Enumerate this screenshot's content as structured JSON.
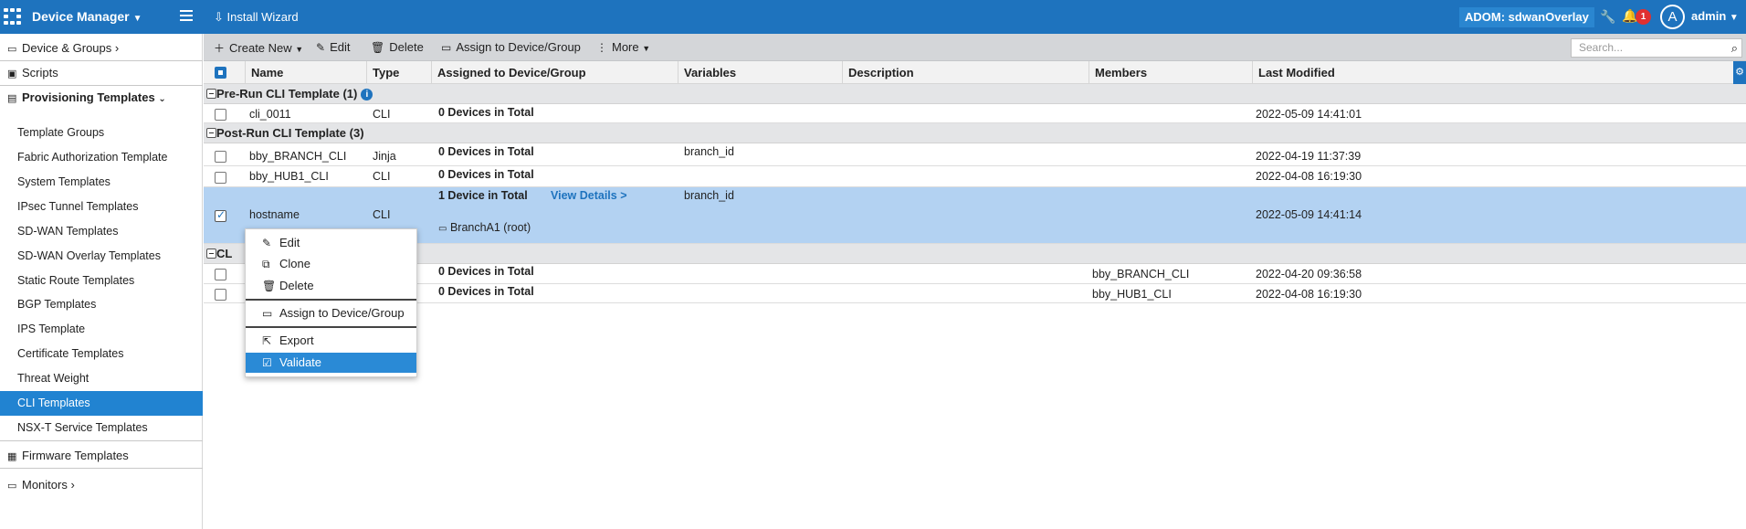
{
  "topbar": {
    "app_title": "Device Manager",
    "install_wizard": "Install Wizard",
    "adom": "ADOM: sdwanOverlay",
    "notification_count": "1",
    "avatar_letter": "A",
    "user": "admin",
    "bar_color": "#1e73be"
  },
  "sidebar": {
    "device_groups": "Device & Groups",
    "scripts": "Scripts",
    "provisioning_templates": "Provisioning Templates",
    "sub_items": [
      "Template Groups",
      "Fabric Authorization Template",
      "System Templates",
      "IPsec Tunnel Templates",
      "SD-WAN Templates",
      "SD-WAN Overlay Templates",
      "Static Route Templates",
      "BGP Templates",
      "IPS Template",
      "Certificate Templates",
      "Threat Weight",
      "CLI Templates",
      "NSX-T Service Templates"
    ],
    "active_item": "CLI Templates",
    "firmware_templates": "Firmware Templates",
    "monitors": "Monitors"
  },
  "toolbar": {
    "create_new": "Create New",
    "edit": "Edit",
    "delete": "Delete",
    "assign": "Assign to Device/Group",
    "more": "More",
    "search_placeholder": "Search..."
  },
  "table": {
    "columns": [
      "Name",
      "Type",
      "Assigned to Device/Group",
      "Variables",
      "Description",
      "Members",
      "Last Modified"
    ],
    "groups": [
      {
        "title": "Pre-Run CLI Template (1)",
        "rows": [
          {
            "name": "cli_0011",
            "type": "CLI",
            "assigned": "0 Devices in Total",
            "variables": "",
            "members": "",
            "modified": "2022-05-09 14:41:01"
          }
        ]
      },
      {
        "title": "Post-Run CLI Template (3)",
        "rows": [
          {
            "name": "bby_BRANCH_CLI",
            "type": "Jinja",
            "assigned": "0 Devices in Total",
            "variables": "branch_id",
            "members": "",
            "modified": "2022-04-19 11:37:39"
          },
          {
            "name": "bby_HUB1_CLI",
            "type": "CLI",
            "assigned": "0 Devices in Total",
            "variables": "",
            "members": "",
            "modified": "2022-04-08 16:19:30"
          },
          {
            "name": "hostname",
            "type": "CLI",
            "assigned": "1 Device in Total",
            "view_details": "View Details >",
            "device": "BranchA1 (root)",
            "variables": "branch_id",
            "members": "",
            "modified": "2022-05-09 14:41:14",
            "selected": true
          }
        ]
      },
      {
        "title": "CL",
        "rows": [
          {
            "name": "",
            "type": "",
            "assigned": "0 Devices in Total",
            "variables": "",
            "members": "bby_BRANCH_CLI",
            "modified": "2022-04-20 09:36:58"
          },
          {
            "name": "",
            "type": "",
            "assigned": "0 Devices in Total",
            "variables": "",
            "members": "bby_HUB1_CLI",
            "modified": "2022-04-08 16:19:30"
          }
        ]
      }
    ]
  },
  "context_menu": {
    "items": [
      "Edit",
      "Clone",
      "Delete",
      "Assign to Device/Group",
      "Export",
      "Validate"
    ],
    "highlighted": "Validate",
    "highlight_color": "#2a8ad6"
  }
}
